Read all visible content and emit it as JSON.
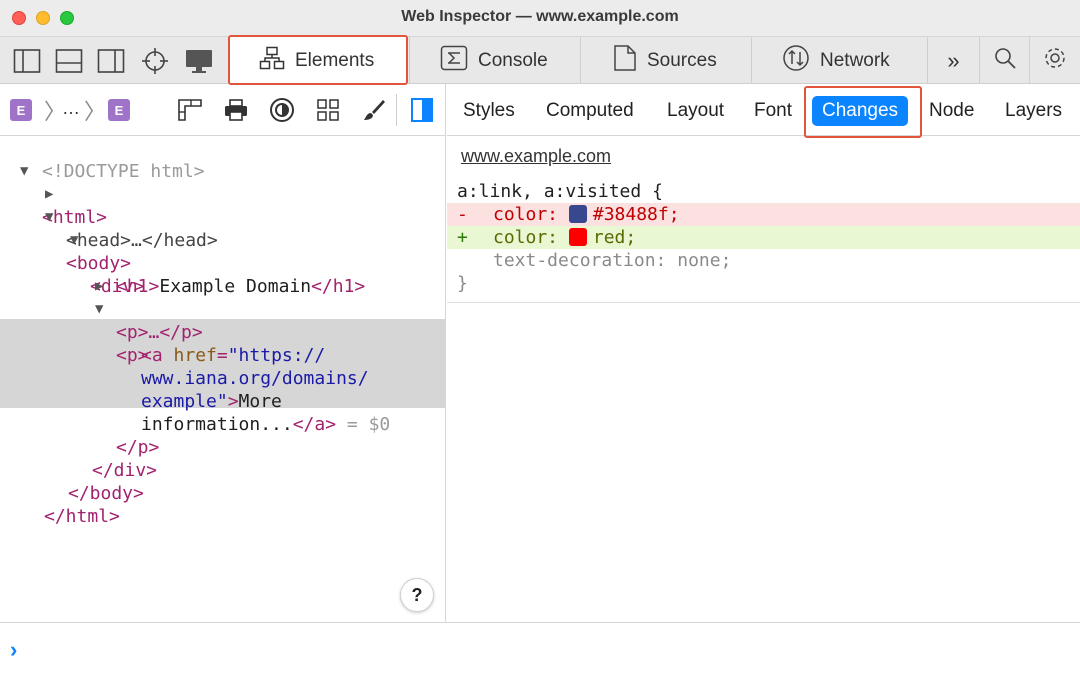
{
  "window": {
    "title": "Web Inspector — www.example.com"
  },
  "tabbar": {
    "tabs": [
      {
        "label": "Elements",
        "icon": "elements-icon",
        "active": true
      },
      {
        "label": "Console",
        "icon": "console-icon"
      },
      {
        "label": "Sources",
        "icon": "sources-icon"
      },
      {
        "label": "Network",
        "icon": "network-icon"
      }
    ],
    "more": "»",
    "highlight_color": "#e2553a"
  },
  "breadcrumb": {
    "badge": "E",
    "ellipsis": "…"
  },
  "dom": {
    "doctype": "<!DOCTYPE html>",
    "html_open": "<html>",
    "head_collapsed": "<head>…</head>",
    "body_open": "<body>",
    "div_open": "<div>",
    "h1_open": "<h1>",
    "h1_text": "Example Domain",
    "h1_close": "</h1>",
    "p_collapsed": "<p>…</p>",
    "p_open": "<p>",
    "a_open_start": "<a ",
    "a_attr_name": "href",
    "a_attr_eq": "=",
    "a_attr_val_1": "\"https://",
    "a_attr_val_2": "www.iana.org/domains/",
    "a_attr_val_3": "example\"",
    "a_open_end": ">",
    "a_text_1": "More",
    "a_text_2": "information...",
    "a_close": "</a>",
    "console_ref": " = $0",
    "p_close": "</p>",
    "div_close": "</div>",
    "body_close": "</body>",
    "html_close": "</html>"
  },
  "details": {
    "tabs": [
      "Styles",
      "Computed",
      "Layout",
      "Font",
      "Changes",
      "Node",
      "Layers"
    ],
    "active_tab": "Changes"
  },
  "changes": {
    "site": "www.example.com",
    "selector": "a:link, a:visited {",
    "removed": {
      "sign": "-",
      "prop": "color:",
      "value": "#38488f;",
      "swatch": "#38488f"
    },
    "added": {
      "sign": "+",
      "prop": "color:",
      "value": "red;",
      "swatch": "#ff0000"
    },
    "unchanged": "text-decoration: none;",
    "close": "}"
  },
  "help": "?",
  "console": {
    "prompt": "›"
  }
}
